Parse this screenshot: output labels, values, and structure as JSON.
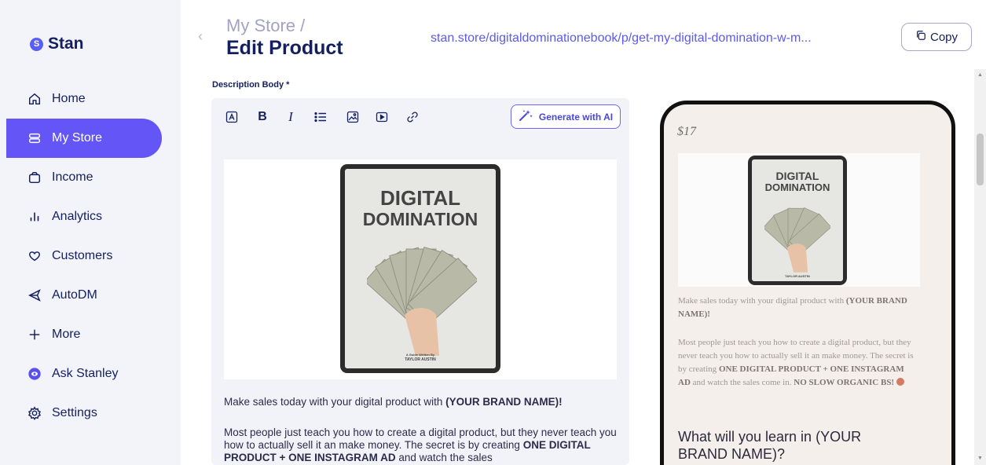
{
  "brand": {
    "name": "Stan",
    "logo_letter": "S"
  },
  "sidebar": {
    "items": [
      {
        "label": "Home",
        "icon": "home-icon"
      },
      {
        "label": "My Store",
        "icon": "store-icon",
        "active": true
      },
      {
        "label": "Income",
        "icon": "wallet-icon"
      },
      {
        "label": "Analytics",
        "icon": "analytics-icon"
      },
      {
        "label": "Customers",
        "icon": "heart-icon"
      },
      {
        "label": "AutoDM",
        "icon": "send-icon"
      },
      {
        "label": "More",
        "icon": "plus-icon"
      },
      {
        "label": "Ask Stanley",
        "icon": "stanley-icon"
      },
      {
        "label": "Settings",
        "icon": "gear-icon"
      }
    ]
  },
  "header": {
    "breadcrumb_parent": "My Store /",
    "title": "Edit Product",
    "store_url": "stan.store/digitaldominationebook/p/get-my-digital-domination-w-m...",
    "copy_label": "Copy"
  },
  "editor": {
    "section_label": "Description Body *",
    "toolbar": {
      "bold": "B",
      "italic": "I",
      "generate_label": "Generate with AI"
    },
    "cover": {
      "title_line1": "DIGITAL",
      "title_line2": "DOMINATION",
      "byline": "A Guide Written By",
      "author": "TAYLOR AUSTIN"
    },
    "paragraph1_text": "Make sales today with your digital product with ",
    "paragraph1_bold": "(YOUR BRAND NAME)!",
    "paragraph2_text": "Most people just teach you how to create a digital product, but they never teach you how to actually sell it an make money. The secret is by creating ",
    "paragraph2_bold": "ONE DIGITAL PRODUCT + ONE INSTAGRAM AD",
    "paragraph2_tail": " and watch the sales"
  },
  "preview": {
    "price": "$17",
    "cover_title_line1": "DIGITAL",
    "cover_title_line2": "DOMINATION",
    "cover_author": "TAYLOR AUSTIN",
    "p1_text": "Make sales today with your digital product with ",
    "p1_bold": "(YOUR BRAND NAME)!",
    "p2_text": "Most people just teach you how to create a digital product, but they never teach you how to actually sell it an make money. The secret is by creating ",
    "p2_bold1": "ONE DIGITAL PRODUCT + ONE INSTAGRAM AD",
    "p2_mid": " and watch the sales come in. ",
    "p2_bold2": "NO SLOW ORGANIC BS!",
    "heading": "What will you learn in (YOUR BRAND NAME)?"
  },
  "colors": {
    "accent": "#6355f6",
    "link": "#5d59f0",
    "navy": "#131f60"
  }
}
